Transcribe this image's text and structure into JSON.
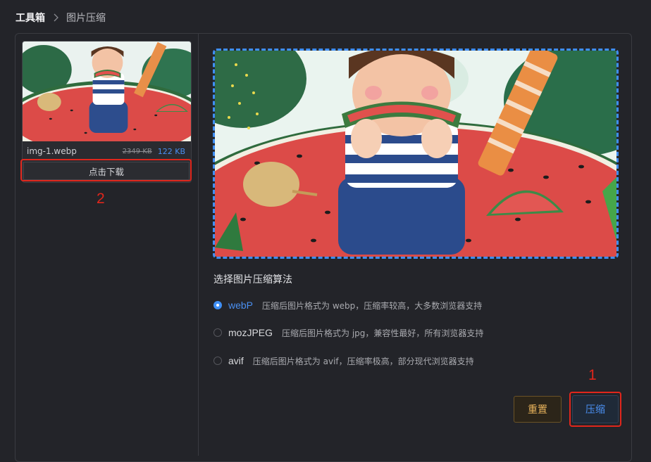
{
  "breadcrumb": {
    "root": "工具箱",
    "current": "图片压缩"
  },
  "file": {
    "name": "img-1.webp",
    "original_size": "2349 KB",
    "compressed_size": "122 KB",
    "download_label": "点击下载"
  },
  "annotations": {
    "download_marker": "2",
    "compress_marker": "1"
  },
  "algorithm": {
    "title": "选择图片压缩算法",
    "selected": "webP",
    "options": [
      {
        "name": "webP",
        "desc": "压缩后图片格式为 webp，压缩率较高，大多数浏览器支持"
      },
      {
        "name": "mozJPEG",
        "desc": "压缩后图片格式为 jpg，兼容性最好，所有浏览器支持"
      },
      {
        "name": "avif",
        "desc": "压缩后图片格式为 avif，压缩率极高，部分现代浏览器支持"
      }
    ]
  },
  "actions": {
    "reset_label": "重置",
    "compress_label": "压缩"
  },
  "colors": {
    "accent": "#3f8ff5",
    "annotation": "#e0261c",
    "reset_text": "#e7b25b"
  },
  "icons": {
    "separator": "chevron-right-icon"
  }
}
